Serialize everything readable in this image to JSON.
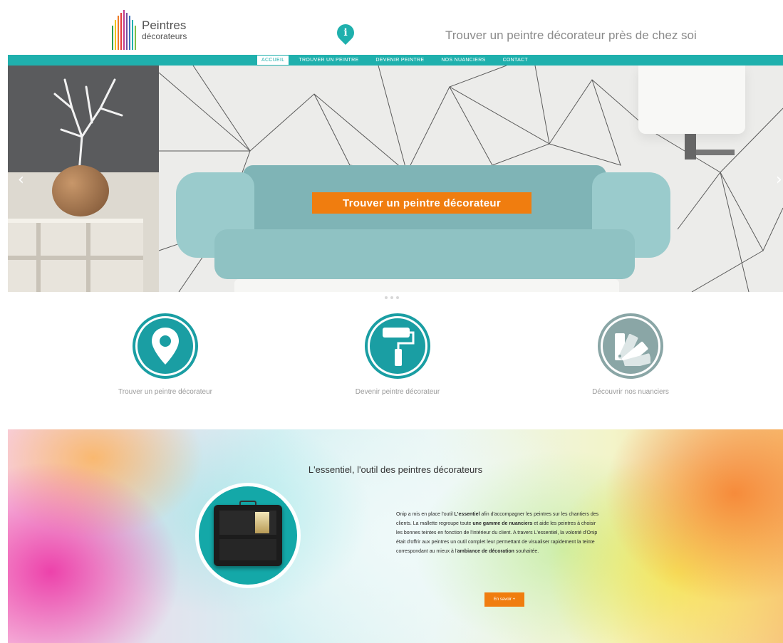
{
  "header": {
    "logo": {
      "line1": "Peintres",
      "line2": "décorateurs"
    },
    "info_icon": "info-icon",
    "tagline": "Trouver un peintre décorateur près de chez soi"
  },
  "nav": {
    "items": [
      {
        "label": "ACCUEIL",
        "active": true
      },
      {
        "label": "TROUVER UN PEINTRE",
        "active": false
      },
      {
        "label": "DEVENIR PEINTRE",
        "active": false
      },
      {
        "label": "NOS NUANCIERS",
        "active": false
      },
      {
        "label": "CONTACT",
        "active": false
      }
    ]
  },
  "hero": {
    "cta_label": "Trouver un peintre décorateur",
    "prev_arrow": "‹",
    "next_arrow": "›"
  },
  "features": [
    {
      "label": "Trouver un peintre décorateur",
      "icon": "map-pin-icon"
    },
    {
      "label": "Devenir peintre décorateur",
      "icon": "paint-roller-icon"
    },
    {
      "label": "Découvrir nos nuanciers",
      "icon": "color-swatch-icon"
    }
  ],
  "banner": {
    "title": "L'essentiel, l'outil des peintres décorateurs",
    "text_parts": [
      {
        "t": "Onip a mis en place l'outil ",
        "b": false
      },
      {
        "t": "L'essentiel",
        "b": true
      },
      {
        "t": " afin d'accompagner les peintres sur les chantiers des clients. La mallette regroupe toute ",
        "b": false
      },
      {
        "t": "une gamme de nuanciers",
        "b": true
      },
      {
        "t": " et aide les peintres à choisir les bonnes teintes en fonction de l'intérieur du client. A travers L'essentiel, la volonté d'Onip était d'offrir aux peintres un outil complet leur permettant de visualiser rapidement la teinte correspondant au mieux à l'",
        "b": false
      },
      {
        "t": "ambiance de décoration",
        "b": true
      },
      {
        "t": " souhaitée.",
        "b": false
      }
    ],
    "button_label": "En savoir +"
  },
  "colors": {
    "teal": "#1fb0ad",
    "orange": "#f07d0f",
    "grey_icon": "#8aa6a6"
  }
}
